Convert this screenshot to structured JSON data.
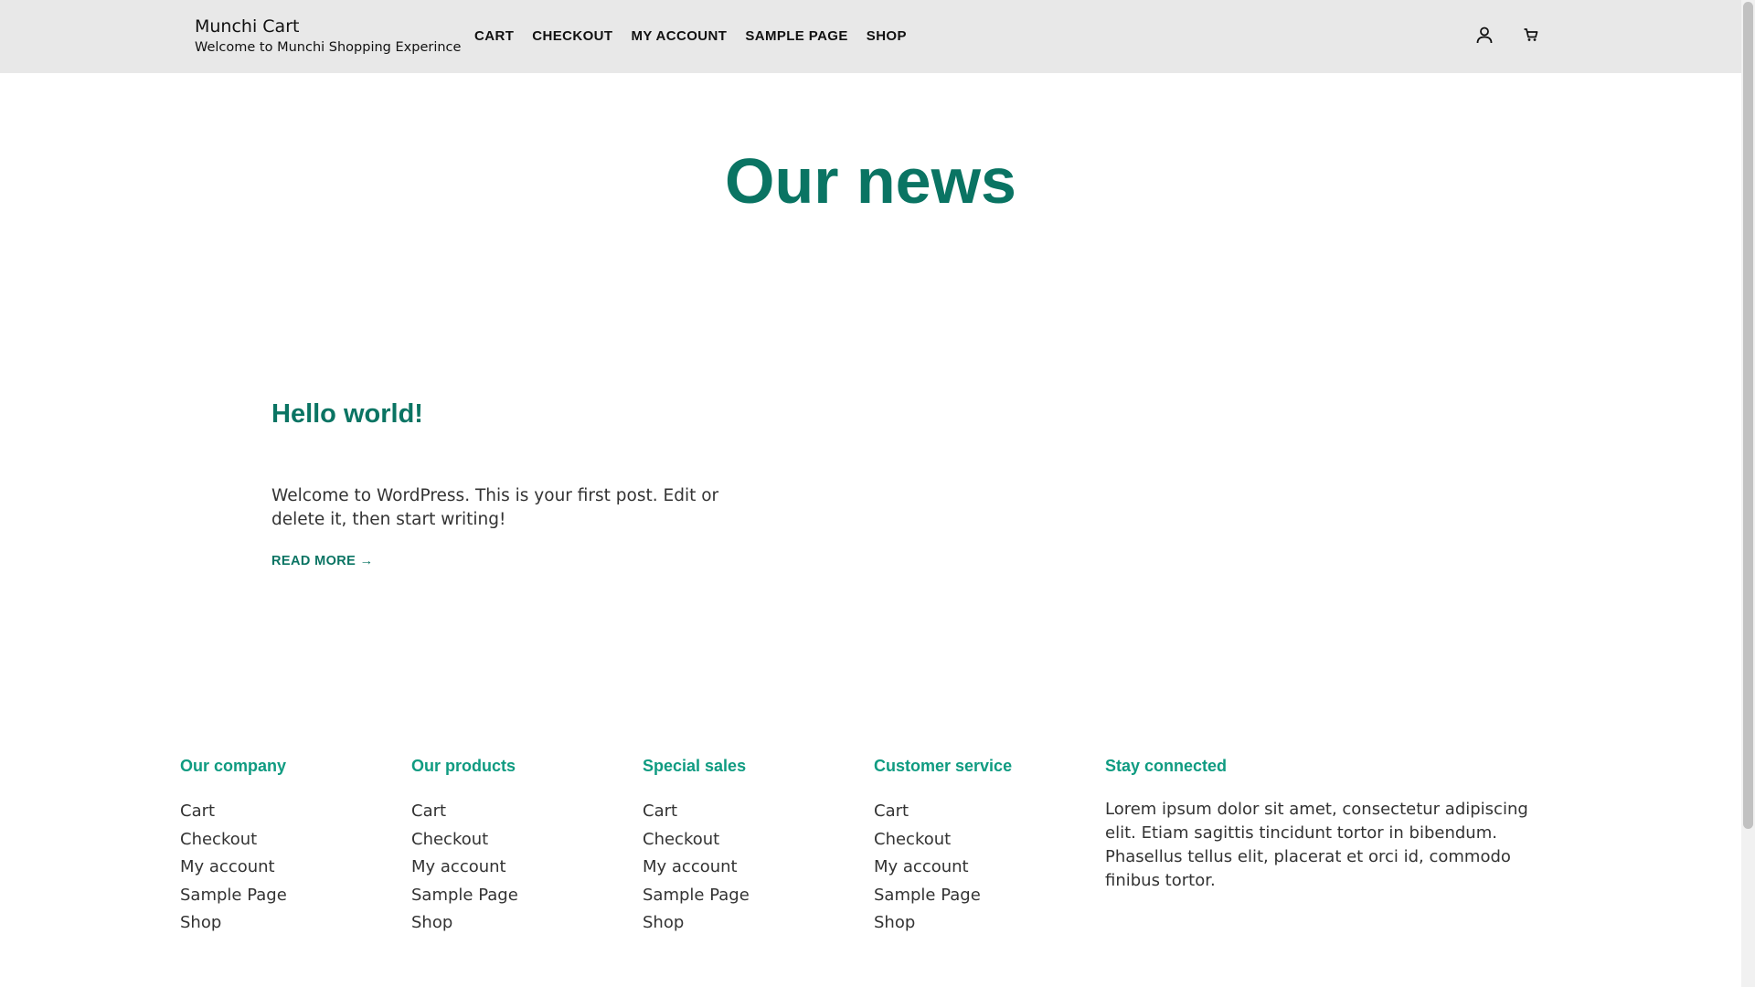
{
  "header": {
    "site_title": "Munchi Cart",
    "tagline": "Welcome to Munchi Shopping Experince",
    "nav": [
      "CART",
      "CHECKOUT",
      "MY ACCOUNT",
      "SAMPLE PAGE",
      "SHOP"
    ],
    "icons": {
      "account": "user-icon",
      "cart": "cart-icon"
    }
  },
  "main": {
    "heading": "Our news",
    "post": {
      "title": "Hello world!",
      "excerpt": "Welcome to WordPress. This is your first post. Edit or delete it, then start writing!",
      "read_more": "READ MORE →"
    }
  },
  "footer": {
    "columns": [
      {
        "heading": "Our company",
        "links": [
          "Cart",
          "Checkout",
          "My account",
          "Sample Page",
          "Shop"
        ]
      },
      {
        "heading": "Our products",
        "links": [
          "Cart",
          "Checkout",
          "My account",
          "Sample Page",
          "Shop"
        ]
      },
      {
        "heading": "Special sales",
        "links": [
          "Cart",
          "Checkout",
          "My account",
          "Sample Page",
          "Shop"
        ]
      },
      {
        "heading": "Customer service",
        "links": [
          "Cart",
          "Checkout",
          "My account",
          "Sample Page",
          "Shop"
        ]
      }
    ],
    "stay_connected": {
      "heading": "Stay connected",
      "text": "Lorem ipsum dolor sit amet, consectetur adipiscing elit. Etiam sagittis tincidunt tortor in bibendum. Phasellus tellus elit, placerat et orci id, commodo finibus tortor."
    }
  },
  "colors": {
    "accent": "#0a7463",
    "footer_heading": "#0f9b81",
    "header_bg": "#e8e8e8",
    "text": "#333333"
  }
}
